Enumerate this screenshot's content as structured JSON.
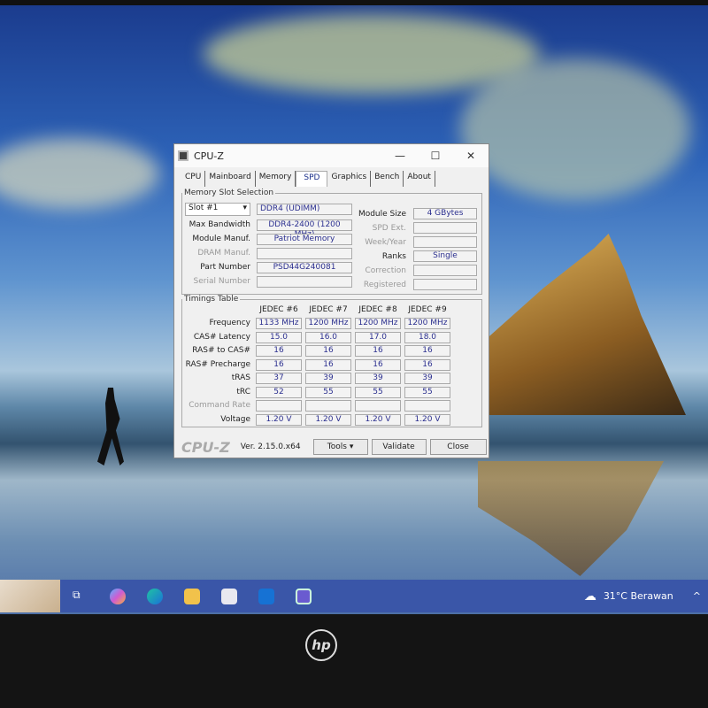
{
  "window": {
    "title": "CPU-Z",
    "minimize": "—",
    "maximize": "☐",
    "close": "✕"
  },
  "tabs": [
    "CPU",
    "Mainboard",
    "Memory",
    "SPD",
    "Graphics",
    "Bench",
    "About"
  ],
  "active_tab": "SPD",
  "slot": {
    "legend": "Memory Slot Selection",
    "selected": "Slot #1",
    "type": "DDR4 (UDIMM)",
    "max_bandwidth_label": "Max Bandwidth",
    "max_bandwidth": "DDR4-2400 (1200 MHz)",
    "module_manuf_label": "Module Manuf.",
    "module_manuf": "Patriot Memory",
    "dram_manuf_label": "DRAM Manuf.",
    "dram_manuf": "",
    "part_number_label": "Part Number",
    "part_number": "PSD44G240081",
    "serial_number_label": "Serial Number",
    "serial_number": "",
    "module_size_label": "Module Size",
    "module_size": "4 GBytes",
    "spd_ext_label": "SPD Ext.",
    "spd_ext": "",
    "week_year_label": "Week/Year",
    "week_year": "",
    "ranks_label": "Ranks",
    "ranks": "Single",
    "correction_label": "Correction",
    "correction": "",
    "registered_label": "Registered",
    "registered": ""
  },
  "timings": {
    "legend": "Timings Table",
    "columns": [
      "JEDEC #6",
      "JEDEC #7",
      "JEDEC #8",
      "JEDEC #9"
    ],
    "rows": [
      {
        "label": "Frequency",
        "values": [
          "1133 MHz",
          "1200 MHz",
          "1200 MHz",
          "1200 MHz"
        ]
      },
      {
        "label": "CAS# Latency",
        "values": [
          "15.0",
          "16.0",
          "17.0",
          "18.0"
        ]
      },
      {
        "label": "RAS# to CAS#",
        "values": [
          "16",
          "16",
          "16",
          "16"
        ]
      },
      {
        "label": "RAS# Precharge",
        "values": [
          "16",
          "16",
          "16",
          "16"
        ]
      },
      {
        "label": "tRAS",
        "values": [
          "37",
          "39",
          "39",
          "39"
        ]
      },
      {
        "label": "tRC",
        "values": [
          "52",
          "55",
          "55",
          "55"
        ]
      },
      {
        "label": "Command Rate",
        "values": [
          "",
          "",
          "",
          ""
        ]
      },
      {
        "label": "Voltage",
        "values": [
          "1.20 V",
          "1.20 V",
          "1.20 V",
          "1.20 V"
        ]
      }
    ]
  },
  "footer": {
    "logo": "CPU-Z",
    "version": "Ver. 2.15.0.x64",
    "tools": "Tools",
    "validate": "Validate",
    "close": "Close"
  },
  "taskbar": {
    "weather": "31°C  Berawan",
    "chevron": "^"
  },
  "monitor": {
    "brand": "hp"
  }
}
